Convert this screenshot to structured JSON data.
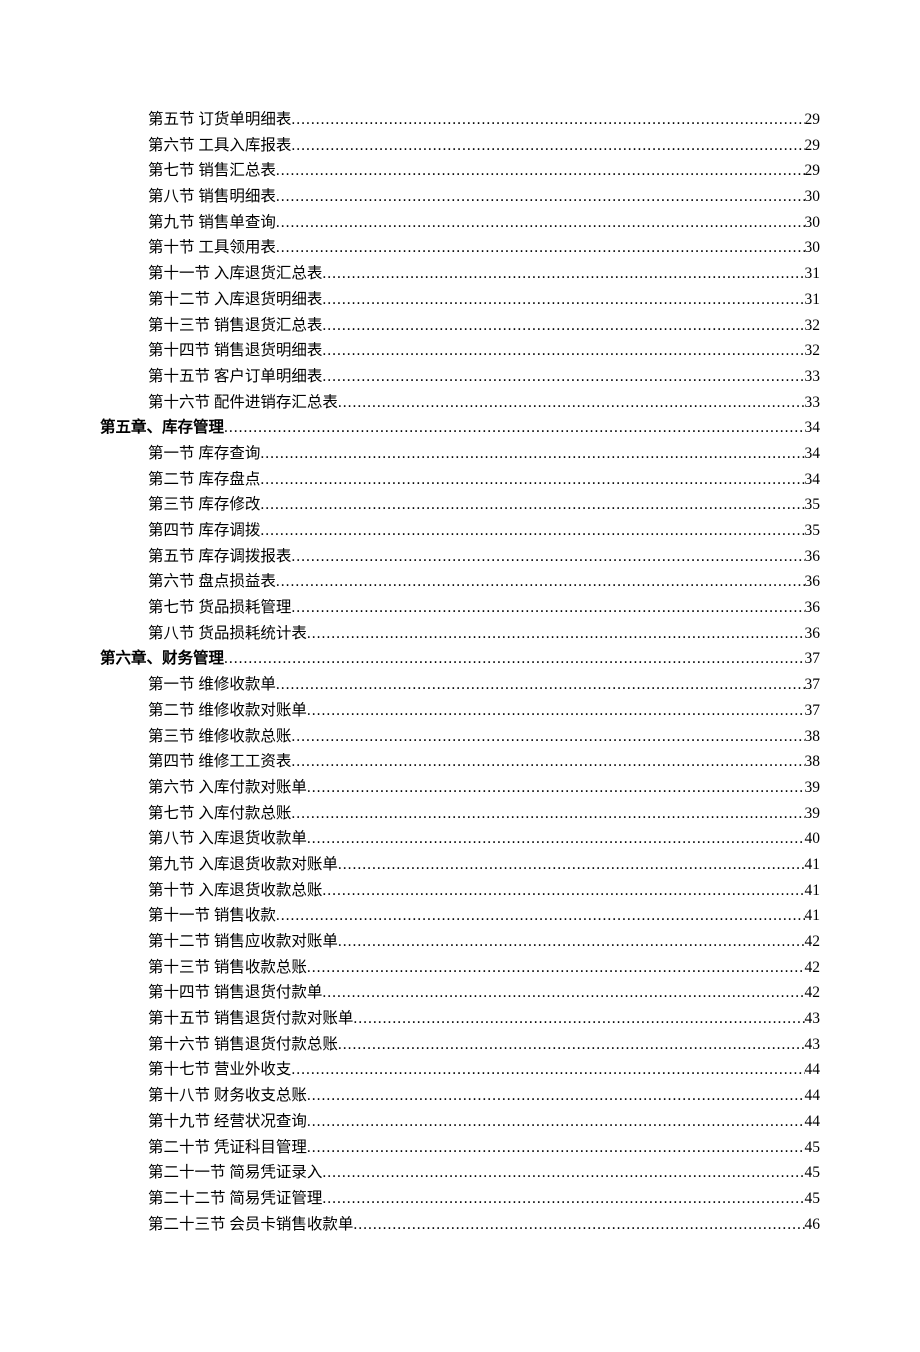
{
  "toc": [
    {
      "level": "section",
      "label": "第五节 订货单明细表",
      "page": "29"
    },
    {
      "level": "section",
      "label": "第六节 工具入库报表",
      "page": "29"
    },
    {
      "level": "section",
      "label": "第七节 销售汇总表",
      "page": "29"
    },
    {
      "level": "section",
      "label": "第八节 销售明细表",
      "page": "30"
    },
    {
      "level": "section",
      "label": "第九节 销售单查询",
      "page": "30"
    },
    {
      "level": "section",
      "label": "第十节 工具领用表",
      "page": "30"
    },
    {
      "level": "section",
      "label": "第十一节 入库退货汇总表",
      "page": "31"
    },
    {
      "level": "section",
      "label": "第十二节 入库退货明细表",
      "page": "31"
    },
    {
      "level": "section",
      "label": "第十三节 销售退货汇总表",
      "page": "32"
    },
    {
      "level": "section",
      "label": "第十四节 销售退货明细表",
      "page": "32"
    },
    {
      "level": "section",
      "label": "第十五节 客户订单明细表",
      "page": "33"
    },
    {
      "level": "section",
      "label": "第十六节 配件进销存汇总表",
      "page": "33"
    },
    {
      "level": "chapter",
      "label": "第五章、库存管理",
      "page": "34"
    },
    {
      "level": "section",
      "label": "第一节 库存查询",
      "page": "34"
    },
    {
      "level": "section",
      "label": "第二节 库存盘点",
      "page": "34"
    },
    {
      "level": "section",
      "label": "第三节 库存修改",
      "page": "35"
    },
    {
      "level": "section",
      "label": "第四节 库存调拨",
      "page": "35"
    },
    {
      "level": "section",
      "label": "第五节 库存调拨报表",
      "page": "36"
    },
    {
      "level": "section",
      "label": "第六节 盘点损益表",
      "page": "36"
    },
    {
      "level": "section",
      "label": "第七节 货品损耗管理",
      "page": "36"
    },
    {
      "level": "section",
      "label": "第八节 货品损耗统计表",
      "page": "36"
    },
    {
      "level": "chapter",
      "label": "第六章、财务管理",
      "page": "37"
    },
    {
      "level": "section",
      "label": "第一节 维修收款单",
      "page": "37"
    },
    {
      "level": "section",
      "label": "第二节 维修收款对账单",
      "page": "37"
    },
    {
      "level": "section",
      "label": "第三节 维修收款总账",
      "page": "38"
    },
    {
      "level": "section",
      "label": "第四节 维修工工资表",
      "page": "38"
    },
    {
      "level": "section",
      "label": "第六节 入库付款对账单",
      "page": "39"
    },
    {
      "level": "section",
      "label": "第七节 入库付款总账",
      "page": "39"
    },
    {
      "level": "section",
      "label": "第八节 入库退货收款单",
      "page": "40"
    },
    {
      "level": "section",
      "label": "第九节 入库退货收款对账单",
      "page": "41"
    },
    {
      "level": "section",
      "label": "第十节 入库退货收款总账",
      "page": "41"
    },
    {
      "level": "section",
      "label": "第十一节 销售收款",
      "page": "41"
    },
    {
      "level": "section",
      "label": "第十二节 销售应收款对账单",
      "page": "42"
    },
    {
      "level": "section",
      "label": "第十三节 销售收款总账",
      "page": "42"
    },
    {
      "level": "section",
      "label": "第十四节 销售退货付款单",
      "page": "42"
    },
    {
      "level": "section",
      "label": "第十五节 销售退货付款对账单",
      "page": "43"
    },
    {
      "level": "section",
      "label": "第十六节 销售退货付款总账",
      "page": "43"
    },
    {
      "level": "section",
      "label": "第十七节 营业外收支",
      "page": "44"
    },
    {
      "level": "section",
      "label": "第十八节 财务收支总账",
      "page": "44"
    },
    {
      "level": "section",
      "label": "第十九节 经营状况查询",
      "page": "44"
    },
    {
      "level": "section",
      "label": "第二十节 凭证科目管理",
      "page": "45"
    },
    {
      "level": "section",
      "label": "第二十一节 简易凭证录入",
      "page": "45"
    },
    {
      "level": "section",
      "label": "第二十二节 简易凭证管理",
      "page": "45"
    },
    {
      "level": "section",
      "label": "第二十三节 会员卡销售收款单",
      "page": "46"
    }
  ]
}
